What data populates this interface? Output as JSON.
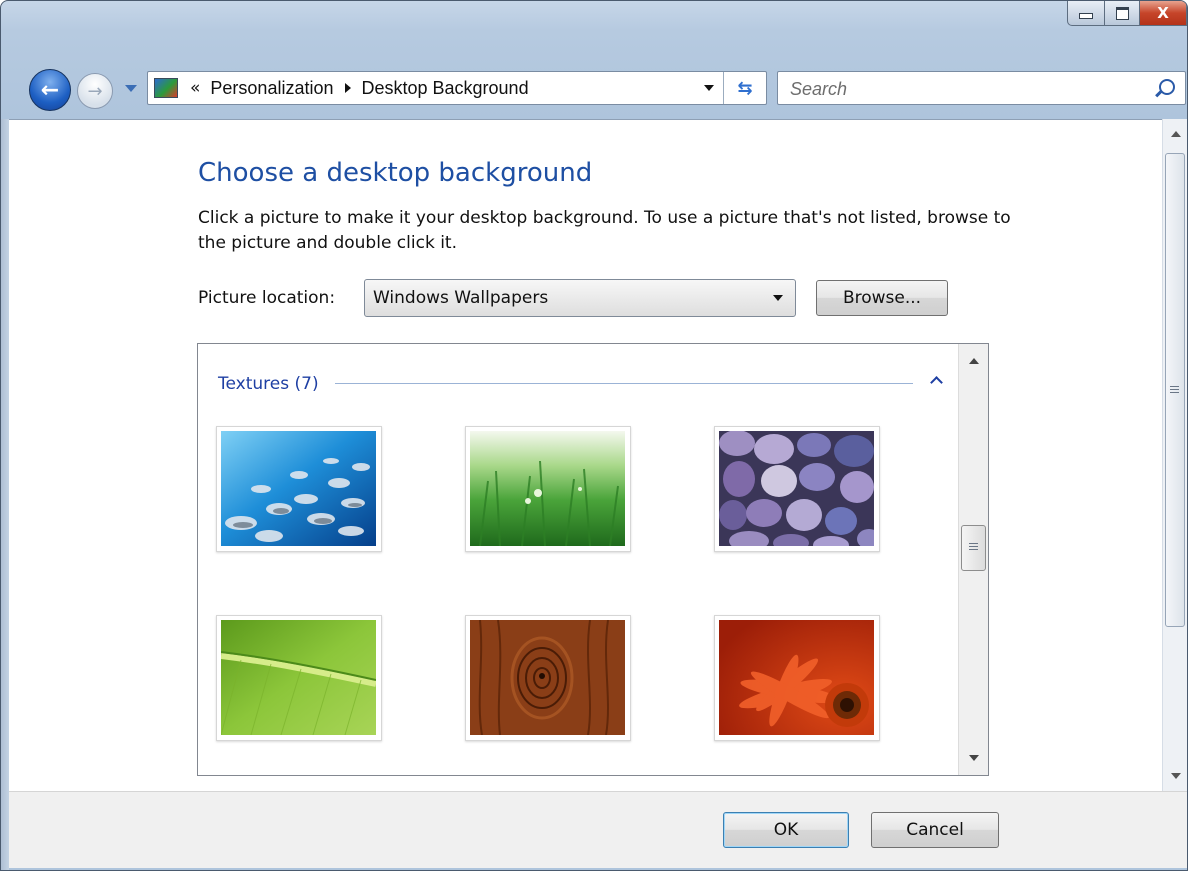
{
  "window": {
    "controls": {
      "minimize_icon": "minimize-icon",
      "maximize_icon": "maximize-icon",
      "close_glyph": "X"
    }
  },
  "navigation": {
    "back_icon": "back-arrow-icon",
    "forward_icon": "forward-arrow-icon",
    "breadcrumb_overflow": "«",
    "breadcrumbs": [
      "Personalization",
      "Desktop Background"
    ],
    "search_placeholder": "Search"
  },
  "main": {
    "heading": "Choose a desktop background",
    "description": "Click a picture to make it your desktop background. To use a picture that's not listed, browse to the picture and double click it.",
    "picture_location_label": "Picture location:",
    "picture_location_value": "Windows Wallpapers",
    "browse_label": "Browse..."
  },
  "gallery": {
    "group_label": "Textures (7)",
    "thumbnails": [
      {
        "name": "fish-underwater"
      },
      {
        "name": "green-grass"
      },
      {
        "name": "purple-pebbles"
      },
      {
        "name": "green-leaf"
      },
      {
        "name": "wood-knot"
      },
      {
        "name": "red-flower"
      }
    ]
  },
  "footer": {
    "ok_label": "OK",
    "cancel_label": "Cancel"
  },
  "colors": {
    "heading": "#1e4fa3",
    "group_label": "#1e3fa3",
    "accent_blue": "#2f6fcf"
  }
}
